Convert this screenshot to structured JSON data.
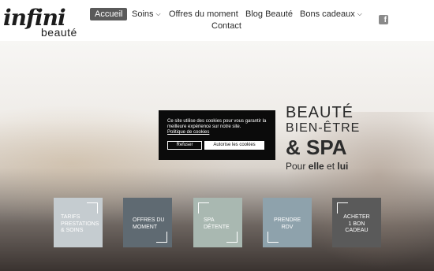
{
  "logo": {
    "script": "infini",
    "sub": "beauté"
  },
  "nav": {
    "items": [
      {
        "label": "Accueil",
        "active": true
      },
      {
        "label": "Soins",
        "dropdown": true
      },
      {
        "label": "Offres du moment"
      },
      {
        "label": "Blog Beauté"
      },
      {
        "label": "Bons cadeaux",
        "dropdown": true
      },
      {
        "label": "Contact"
      }
    ],
    "social": "facebook-icon"
  },
  "hero": {
    "line1": "BEAUTÉ",
    "line2": "BIEN-ÊTRE",
    "line3": "& SPA",
    "line4_prefix": "Pour ",
    "line4_elle": "elle",
    "line4_mid": " et ",
    "line4_lui": "lui"
  },
  "cookie": {
    "text": "Ce site utilise des cookies pour vous garantir la meilleure expérience sur notre site.",
    "link": "Politique de cookies",
    "refuse": "Refuser",
    "accept": "Autorise les cookies"
  },
  "tiles": [
    {
      "label": "TARIFS PRESTATIONS & SOINS",
      "color": "#c5ccd0"
    },
    {
      "label": "OFFRES DU MOMENT",
      "color": "#5f6a72"
    },
    {
      "label": "SPA DÉTENTE",
      "color": "#a9b8b1"
    },
    {
      "label": "PRENDRE RDV",
      "color": "#8ea2ac"
    },
    {
      "label": "ACHETER 1 BON CADEAU",
      "color": "#5a5a5a"
    }
  ]
}
